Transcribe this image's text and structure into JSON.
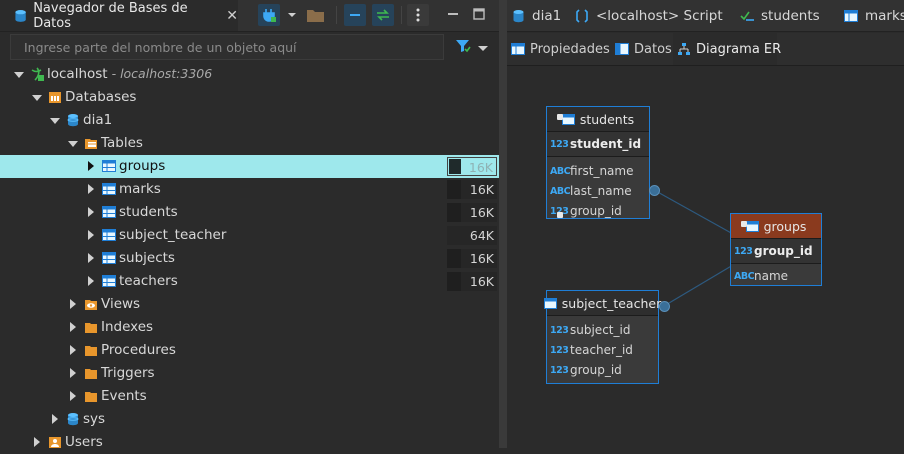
{
  "navigator": {
    "title": "Navegador de Bases de Datos",
    "filter_placeholder": "Ingrese parte del nombre de un objeto aquí",
    "connection": {
      "name": "localhost",
      "address": " - localhost:3306"
    },
    "nodes": [
      {
        "label": "Databases"
      },
      {
        "label": "dia1"
      },
      {
        "label": "Tables"
      }
    ],
    "tables": [
      {
        "label": "groups",
        "size": "16K"
      },
      {
        "label": "marks",
        "size": "16K"
      },
      {
        "label": "students",
        "size": "16K"
      },
      {
        "label": "subject_teacher",
        "size": "64K"
      },
      {
        "label": "subjects",
        "size": "16K"
      },
      {
        "label": "teachers",
        "size": "16K"
      }
    ],
    "folders": [
      {
        "label": "Views"
      },
      {
        "label": "Indexes"
      },
      {
        "label": "Procedures"
      },
      {
        "label": "Triggers"
      },
      {
        "label": "Events"
      }
    ],
    "other_nodes": [
      {
        "label": "sys"
      },
      {
        "label": "Users"
      }
    ]
  },
  "editor_tabs": [
    {
      "label": "dia1"
    },
    {
      "label": "<localhost> Script"
    },
    {
      "label": "students"
    },
    {
      "label": "marks"
    }
  ],
  "sub_tabs": [
    {
      "label": "Propiedades"
    },
    {
      "label": "Datos"
    },
    {
      "label": "Diagrama ER"
    }
  ],
  "er": {
    "students": {
      "title": "students",
      "pk": "student_id",
      "columns": [
        {
          "type": "ABC",
          "name": "first_name"
        },
        {
          "type": "ABC",
          "name": "last_name"
        },
        {
          "type": "123",
          "name": "group_id"
        }
      ]
    },
    "groups": {
      "title": "groups",
      "pk": "group_id",
      "columns": [
        {
          "type": "ABC",
          "name": "name"
        }
      ]
    },
    "subject_teacher": {
      "title": "subject_teacher",
      "columns": [
        {
          "type": "123",
          "name": "subject_id"
        },
        {
          "type": "123",
          "name": "teacher_id"
        },
        {
          "type": "123",
          "name": "group_id"
        }
      ]
    },
    "pk_type": "123"
  },
  "colors": {
    "selection": "#9ee8ec",
    "accent_blue": "#1f7ed6",
    "groups_header": "#8a3a1e",
    "folder_orange": "#e8962c"
  },
  "icons": {
    "database": "database-icon",
    "table": "table-icon",
    "folder": "folder-icon",
    "views": "eye-icon",
    "server": "server-icon",
    "users": "users-icon"
  }
}
